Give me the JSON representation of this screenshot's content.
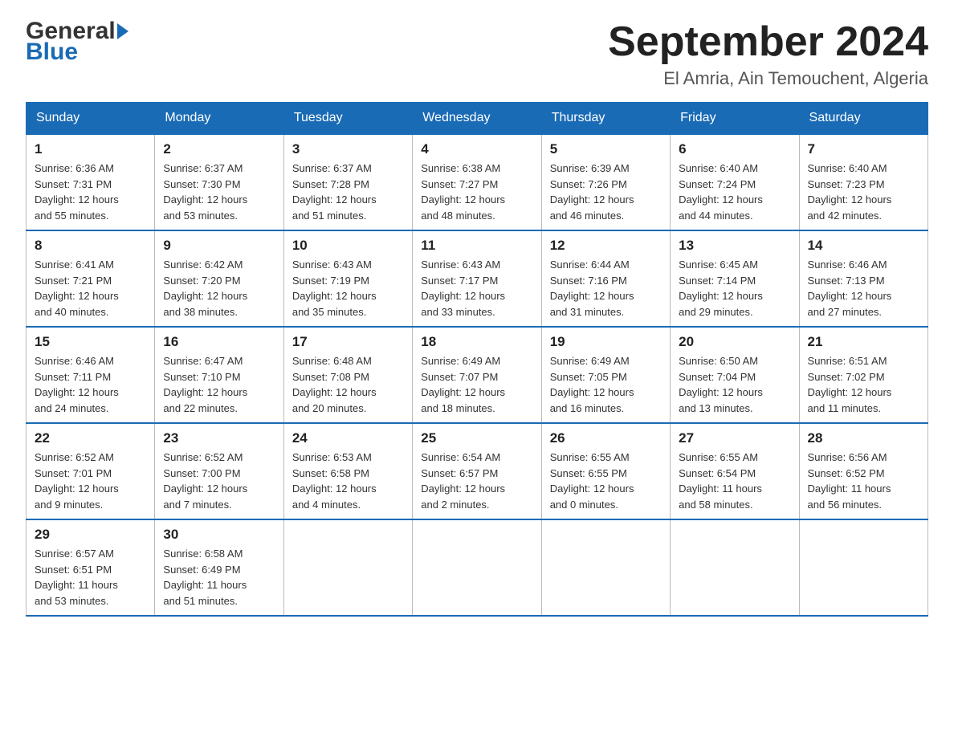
{
  "header": {
    "logo_general": "General",
    "logo_blue": "Blue",
    "title": "September 2024",
    "subtitle": "El Amria, Ain Temouchent, Algeria"
  },
  "weekdays": [
    "Sunday",
    "Monday",
    "Tuesday",
    "Wednesday",
    "Thursday",
    "Friday",
    "Saturday"
  ],
  "weeks": [
    [
      {
        "day": "1",
        "sunrise": "6:36 AM",
        "sunset": "7:31 PM",
        "daylight": "12 hours and 55 minutes."
      },
      {
        "day": "2",
        "sunrise": "6:37 AM",
        "sunset": "7:30 PM",
        "daylight": "12 hours and 53 minutes."
      },
      {
        "day": "3",
        "sunrise": "6:37 AM",
        "sunset": "7:28 PM",
        "daylight": "12 hours and 51 minutes."
      },
      {
        "day": "4",
        "sunrise": "6:38 AM",
        "sunset": "7:27 PM",
        "daylight": "12 hours and 48 minutes."
      },
      {
        "day": "5",
        "sunrise": "6:39 AM",
        "sunset": "7:26 PM",
        "daylight": "12 hours and 46 minutes."
      },
      {
        "day": "6",
        "sunrise": "6:40 AM",
        "sunset": "7:24 PM",
        "daylight": "12 hours and 44 minutes."
      },
      {
        "day": "7",
        "sunrise": "6:40 AM",
        "sunset": "7:23 PM",
        "daylight": "12 hours and 42 minutes."
      }
    ],
    [
      {
        "day": "8",
        "sunrise": "6:41 AM",
        "sunset": "7:21 PM",
        "daylight": "12 hours and 40 minutes."
      },
      {
        "day": "9",
        "sunrise": "6:42 AM",
        "sunset": "7:20 PM",
        "daylight": "12 hours and 38 minutes."
      },
      {
        "day": "10",
        "sunrise": "6:43 AM",
        "sunset": "7:19 PM",
        "daylight": "12 hours and 35 minutes."
      },
      {
        "day": "11",
        "sunrise": "6:43 AM",
        "sunset": "7:17 PM",
        "daylight": "12 hours and 33 minutes."
      },
      {
        "day": "12",
        "sunrise": "6:44 AM",
        "sunset": "7:16 PM",
        "daylight": "12 hours and 31 minutes."
      },
      {
        "day": "13",
        "sunrise": "6:45 AM",
        "sunset": "7:14 PM",
        "daylight": "12 hours and 29 minutes."
      },
      {
        "day": "14",
        "sunrise": "6:46 AM",
        "sunset": "7:13 PM",
        "daylight": "12 hours and 27 minutes."
      }
    ],
    [
      {
        "day": "15",
        "sunrise": "6:46 AM",
        "sunset": "7:11 PM",
        "daylight": "12 hours and 24 minutes."
      },
      {
        "day": "16",
        "sunrise": "6:47 AM",
        "sunset": "7:10 PM",
        "daylight": "12 hours and 22 minutes."
      },
      {
        "day": "17",
        "sunrise": "6:48 AM",
        "sunset": "7:08 PM",
        "daylight": "12 hours and 20 minutes."
      },
      {
        "day": "18",
        "sunrise": "6:49 AM",
        "sunset": "7:07 PM",
        "daylight": "12 hours and 18 minutes."
      },
      {
        "day": "19",
        "sunrise": "6:49 AM",
        "sunset": "7:05 PM",
        "daylight": "12 hours and 16 minutes."
      },
      {
        "day": "20",
        "sunrise": "6:50 AM",
        "sunset": "7:04 PM",
        "daylight": "12 hours and 13 minutes."
      },
      {
        "day": "21",
        "sunrise": "6:51 AM",
        "sunset": "7:02 PM",
        "daylight": "12 hours and 11 minutes."
      }
    ],
    [
      {
        "day": "22",
        "sunrise": "6:52 AM",
        "sunset": "7:01 PM",
        "daylight": "12 hours and 9 minutes."
      },
      {
        "day": "23",
        "sunrise": "6:52 AM",
        "sunset": "7:00 PM",
        "daylight": "12 hours and 7 minutes."
      },
      {
        "day": "24",
        "sunrise": "6:53 AM",
        "sunset": "6:58 PM",
        "daylight": "12 hours and 4 minutes."
      },
      {
        "day": "25",
        "sunrise": "6:54 AM",
        "sunset": "6:57 PM",
        "daylight": "12 hours and 2 minutes."
      },
      {
        "day": "26",
        "sunrise": "6:55 AM",
        "sunset": "6:55 PM",
        "daylight": "12 hours and 0 minutes."
      },
      {
        "day": "27",
        "sunrise": "6:55 AM",
        "sunset": "6:54 PM",
        "daylight": "11 hours and 58 minutes."
      },
      {
        "day": "28",
        "sunrise": "6:56 AM",
        "sunset": "6:52 PM",
        "daylight": "11 hours and 56 minutes."
      }
    ],
    [
      {
        "day": "29",
        "sunrise": "6:57 AM",
        "sunset": "6:51 PM",
        "daylight": "11 hours and 53 minutes."
      },
      {
        "day": "30",
        "sunrise": "6:58 AM",
        "sunset": "6:49 PM",
        "daylight": "11 hours and 51 minutes."
      },
      null,
      null,
      null,
      null,
      null
    ]
  ],
  "labels": {
    "sunrise": "Sunrise:",
    "sunset": "Sunset:",
    "daylight": "Daylight:"
  }
}
